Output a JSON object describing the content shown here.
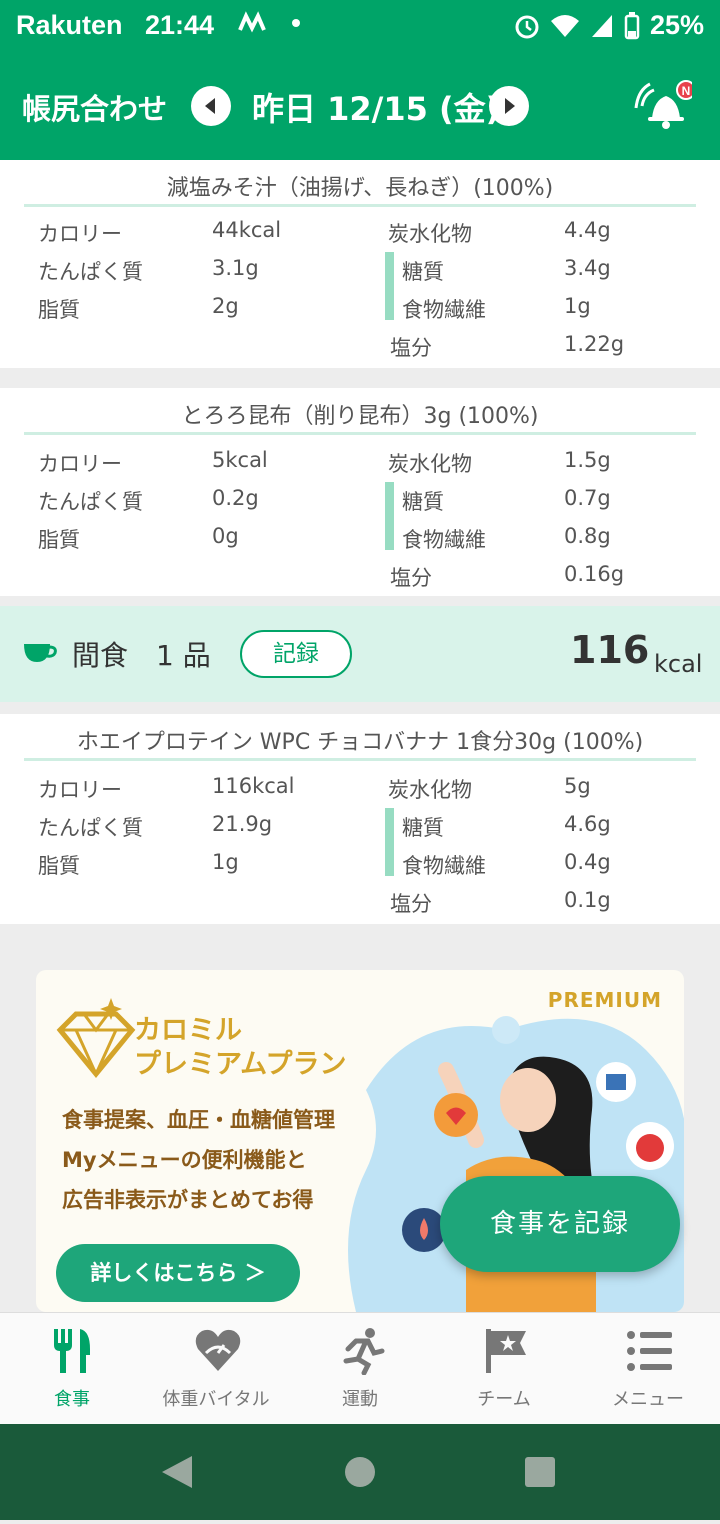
{
  "status_bar": {
    "carrier": "Rakuten",
    "time": "21:44",
    "battery": "25%"
  },
  "header": {
    "title": "帳尻合わせ",
    "date": "昨日 12/15 (金)",
    "notification_badge": "N"
  },
  "nutrient_labels": {
    "calories": "カロリー",
    "protein": "たんぱく質",
    "fat": "脂質",
    "carbs": "炭水化物",
    "sugar": "糖質",
    "fiber": "食物繊維",
    "salt": "塩分"
  },
  "foods": [
    {
      "name": "減塩みそ汁（油揚げ、長ねぎ）(100%)",
      "calories": "44kcal",
      "protein": "3.1g",
      "fat": "2g",
      "carbs": "4.4g",
      "sugar": "3.4g",
      "fiber": "1g",
      "salt": "1.22g"
    },
    {
      "name": "とろろ昆布（削り昆布）3g (100%)",
      "calories": "5kcal",
      "protein": "0.2g",
      "fat": "0g",
      "carbs": "1.5g",
      "sugar": "0.7g",
      "fiber": "0.8g",
      "salt": "0.16g"
    },
    {
      "name": "ホエイプロテイン WPC チョコバナナ 1食分30g (100%)",
      "calories": "116kcal",
      "protein": "21.9g",
      "fat": "1g",
      "carbs": "5g",
      "sugar": "4.6g",
      "fiber": "0.4g",
      "salt": "0.1g"
    }
  ],
  "snack": {
    "label": "間食",
    "count": "1 品",
    "record_label": "記録",
    "kcal": "116",
    "unit": "kcal"
  },
  "promo": {
    "badge": "PREMIUM",
    "name_line1": "カロミル",
    "name_line2": "プレミアムプラン",
    "desc_line1": "食事提案、血圧・血糖値管理",
    "desc_line2": "Myメニューの便利機能と",
    "desc_line3": "広告非表示がまとめてお得",
    "button": "詳しくはこちら ＞"
  },
  "fab_label": "食事を記録",
  "bottom_nav": [
    {
      "label": "食事",
      "active": true
    },
    {
      "label": "体重バイタル",
      "active": false
    },
    {
      "label": "運動",
      "active": false
    },
    {
      "label": "チーム",
      "active": false
    },
    {
      "label": "メニュー",
      "active": false
    }
  ],
  "colors": {
    "primary": "#00a468",
    "accent_light": "#d9f3ea",
    "bar": "#97dcc2",
    "premium_gold": "#d4a42a"
  }
}
